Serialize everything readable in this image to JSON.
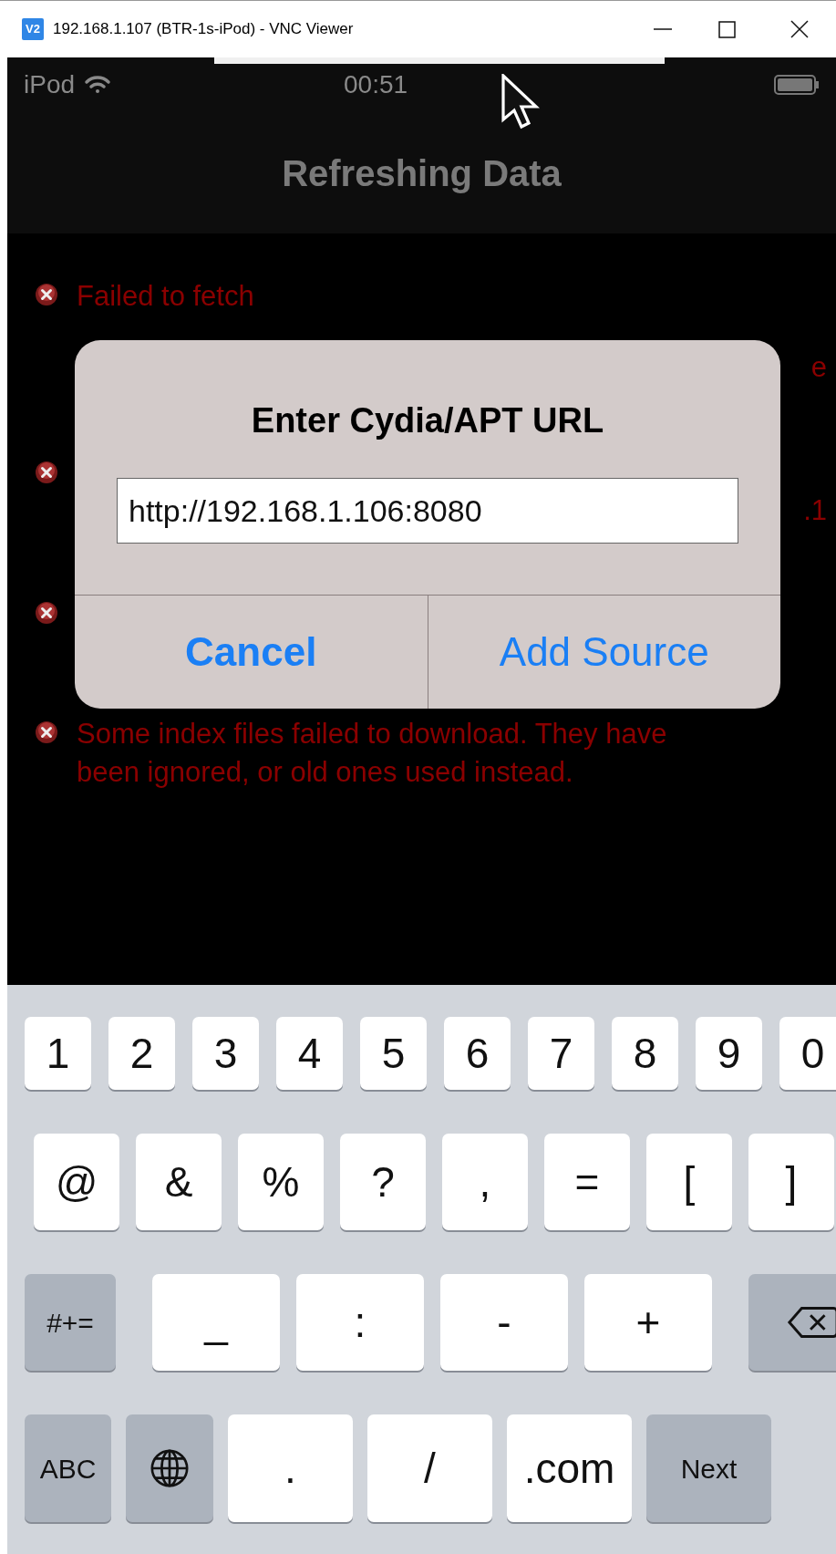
{
  "window": {
    "app_icon": "V2",
    "title": "192.168.1.107 (BTR-1s-iPod) - VNC Viewer"
  },
  "status_bar": {
    "carrier": "iPod",
    "time": "00:51"
  },
  "nav_bar": {
    "title": "Refreshing Data"
  },
  "errors": [
    {
      "kind": "message",
      "text": "Failed to fetch",
      "fragment": "e"
    },
    {
      "kind": "fragment",
      "fragment": ".1"
    },
    {
      "kind": "hidden"
    },
    {
      "kind": "message",
      "text": "Some index files failed to download. They have been ignored, or old ones used instead."
    }
  ],
  "dialog": {
    "title": "Enter Cydia/APT URL",
    "field": {
      "value": "http://192.168.1.106:8080"
    },
    "buttons": [
      {
        "label": "Cancel",
        "bold": true
      },
      {
        "label": "Add Source",
        "bold": false
      }
    ]
  },
  "keyboard": {
    "rows": [
      {
        "keys": [
          {
            "kind": "char",
            "label": "1"
          },
          {
            "kind": "char",
            "label": "2"
          },
          {
            "kind": "char",
            "label": "3"
          },
          {
            "kind": "char",
            "label": "4"
          },
          {
            "kind": "char",
            "label": "5"
          },
          {
            "kind": "char",
            "label": "6"
          },
          {
            "kind": "char",
            "label": "7"
          },
          {
            "kind": "char",
            "label": "8"
          },
          {
            "kind": "char",
            "label": "9"
          },
          {
            "kind": "char",
            "label": "0"
          }
        ]
      },
      {
        "keys": [
          {
            "kind": "char",
            "label": "@"
          },
          {
            "kind": "char",
            "label": "&"
          },
          {
            "kind": "char",
            "label": "%"
          },
          {
            "kind": "char",
            "label": "?"
          },
          {
            "kind": "char",
            "label": ","
          },
          {
            "kind": "char",
            "label": "="
          },
          {
            "kind": "char",
            "label": "["
          },
          {
            "kind": "char",
            "label": "]"
          }
        ]
      },
      {
        "keys": [
          {
            "kind": "function",
            "label": "#+="
          },
          {
            "kind": "char",
            "label": "_"
          },
          {
            "kind": "char",
            "label": ":"
          },
          {
            "kind": "char",
            "label": "-"
          },
          {
            "kind": "char",
            "label": "+"
          },
          {
            "kind": "backspace"
          }
        ]
      },
      {
        "keys": [
          {
            "kind": "function",
            "label": "ABC"
          },
          {
            "kind": "globe"
          },
          {
            "kind": "char",
            "label": "."
          },
          {
            "kind": "char",
            "label": "/"
          },
          {
            "kind": "char",
            "label": ".com"
          },
          {
            "kind": "function",
            "label": "Next"
          }
        ]
      }
    ]
  }
}
